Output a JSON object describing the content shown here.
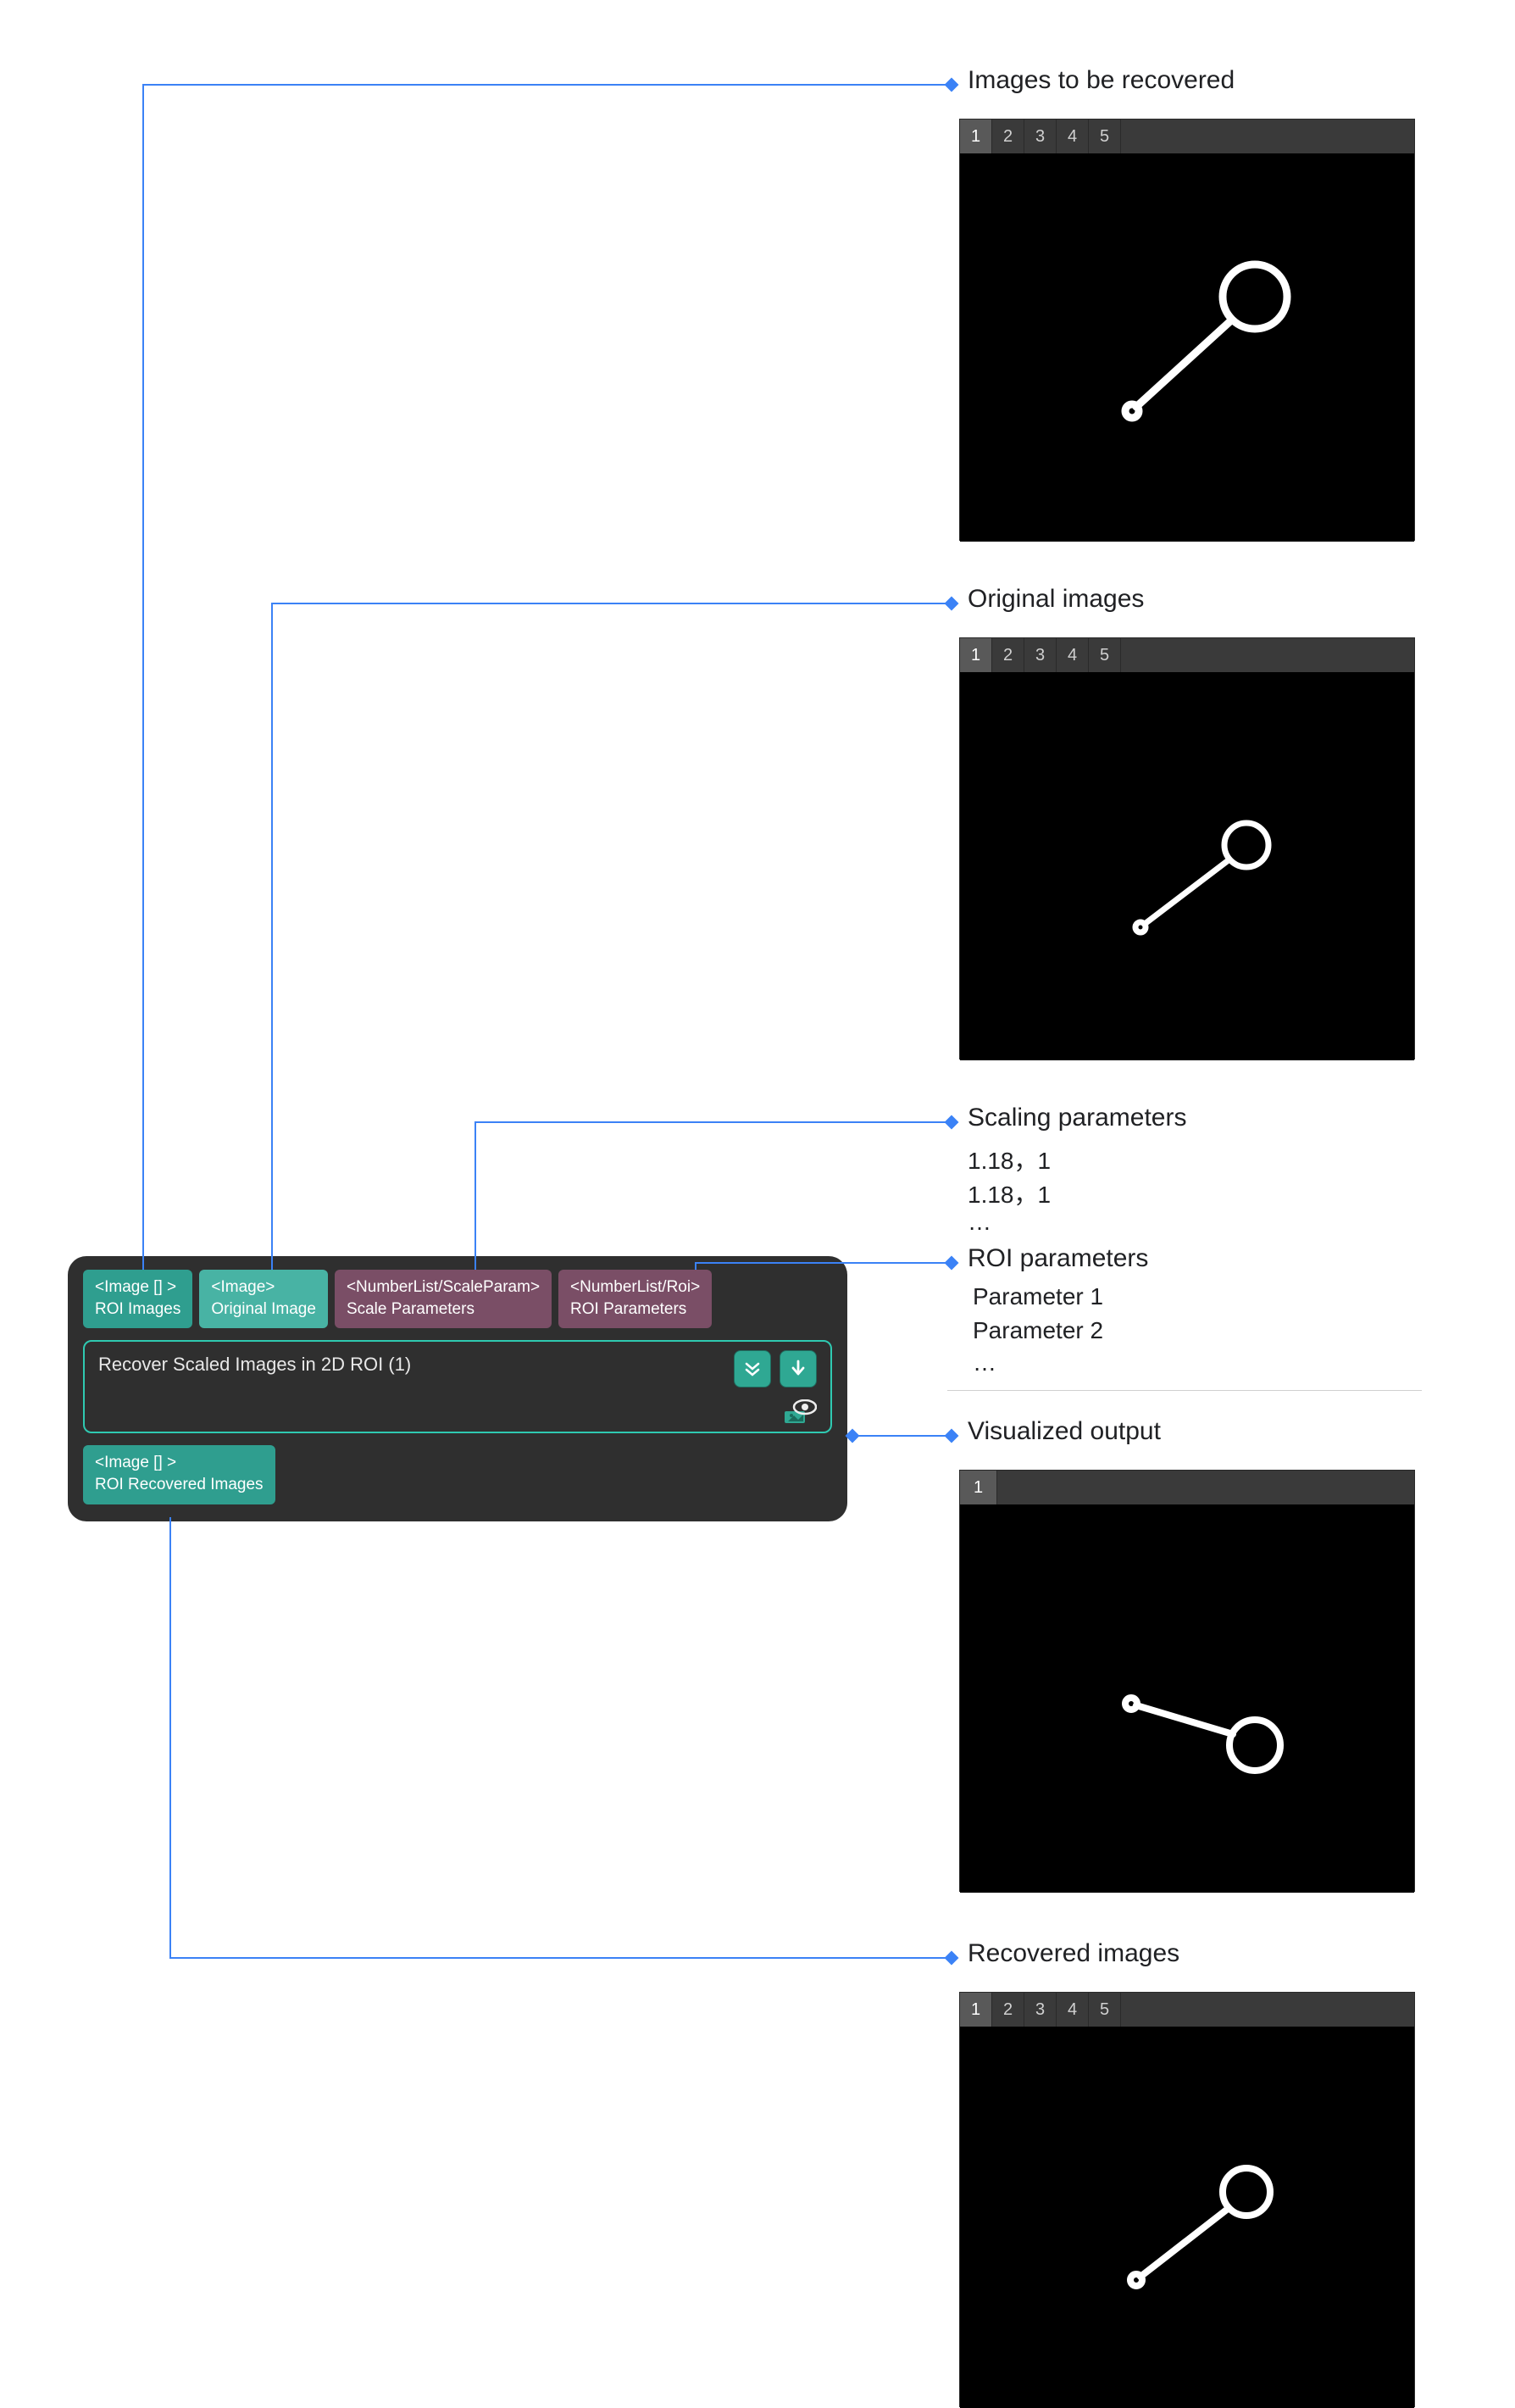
{
  "annotations": {
    "images_to_recover": "Images to be recovered",
    "original_images": "Original images",
    "scaling_params_title": "Scaling parameters",
    "scaling_params_line1": "1.18，1",
    "scaling_params_line2": "1.18，1",
    "scaling_params_more": "…",
    "roi_params_title": "ROI parameters",
    "roi_params_line1": "Parameter 1",
    "roi_params_line2": "Parameter 2",
    "roi_params_more": "…",
    "visualized_output": "Visualized output",
    "recovered_images": "Recovered images"
  },
  "viewer_tabs": [
    "1",
    "2",
    "3",
    "4",
    "5"
  ],
  "viewer_tab_active": "1",
  "node": {
    "title": "Recover Scaled Images in 2D ROI (1)",
    "inputs": [
      {
        "type": "<Image [] >",
        "name": "ROI Images",
        "style": "teal"
      },
      {
        "type": "<Image>",
        "name": "Original Image",
        "style": "teal-light"
      },
      {
        "type": "<NumberList/ScaleParam>",
        "name": "Scale Parameters",
        "style": "purple"
      },
      {
        "type": "<NumberList/Roi>",
        "name": "ROI Parameters",
        "style": "purple"
      }
    ],
    "outputs": [
      {
        "type": "<Image [] >",
        "name": "ROI Recovered Images",
        "style": "teal"
      }
    ]
  }
}
